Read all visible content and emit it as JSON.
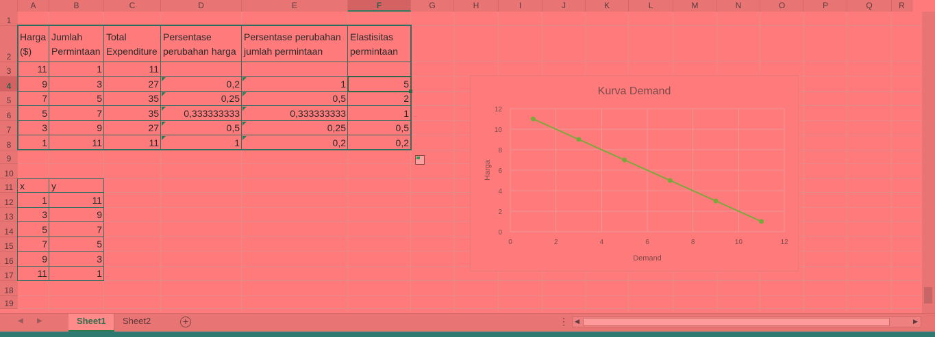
{
  "columns": [
    "A",
    "B",
    "C",
    "D",
    "E",
    "F",
    "G",
    "H",
    "I",
    "J",
    "K",
    "L",
    "M",
    "N",
    "O",
    "P",
    "Q",
    "R"
  ],
  "selected_column": "F",
  "rows": [
    "1",
    "2",
    "3",
    "4",
    "5",
    "6",
    "7",
    "8",
    "9",
    "10",
    "11",
    "12",
    "13",
    "14",
    "15",
    "16",
    "17",
    "18",
    "19"
  ],
  "selected_row": "4",
  "table1": {
    "headers": {
      "A": "Harga ($)",
      "B": "Jumlah Permintaan",
      "C": "Total Expenditure",
      "D": "Persentase perubahan harga",
      "E": "Persentase perubahan jumlah permintaan",
      "F": "Elastisitas permintaan"
    },
    "rows": [
      {
        "A": "11",
        "B": "1",
        "C": "11",
        "D": "",
        "E": "",
        "F": ""
      },
      {
        "A": "9",
        "B": "3",
        "C": "27",
        "D": "0,2",
        "E": "1",
        "F": "5"
      },
      {
        "A": "7",
        "B": "5",
        "C": "35",
        "D": "0,25",
        "E": "0,5",
        "F": "2"
      },
      {
        "A": "5",
        "B": "7",
        "C": "35",
        "D": "0,333333333",
        "E": "0,333333333",
        "F": "1"
      },
      {
        "A": "3",
        "B": "9",
        "C": "27",
        "D": "0,5",
        "E": "0,25",
        "F": "0,5"
      },
      {
        "A": "1",
        "B": "11",
        "C": "11",
        "D": "1",
        "E": "0,2",
        "F": "0,2"
      }
    ]
  },
  "table2": {
    "headers": {
      "A": "x",
      "B": "y"
    },
    "rows": [
      {
        "A": "1",
        "B": "11"
      },
      {
        "A": "3",
        "B": "9"
      },
      {
        "A": "5",
        "B": "7"
      },
      {
        "A": "7",
        "B": "5"
      },
      {
        "A": "9",
        "B": "3"
      },
      {
        "A": "11",
        "B": "1"
      }
    ]
  },
  "chart_data": {
    "type": "line",
    "title": "Kurva Demand",
    "xlabel": "Demand",
    "ylabel": "Harga",
    "xlim": [
      0,
      12
    ],
    "ylim": [
      0,
      12
    ],
    "xticks": [
      0,
      2,
      4,
      6,
      8,
      10,
      12
    ],
    "yticks": [
      0,
      2,
      4,
      6,
      8,
      10,
      12
    ],
    "grid": true,
    "x": [
      1,
      3,
      5,
      7,
      9,
      11
    ],
    "y": [
      11,
      9,
      7,
      5,
      3,
      1
    ],
    "color": "#7aa83a"
  },
  "sheet_tabs": [
    "Sheet1",
    "Sheet2"
  ],
  "active_tab": "Sheet1",
  "colors": {
    "background": "#ff7b7b",
    "accent": "#2f7a55"
  }
}
